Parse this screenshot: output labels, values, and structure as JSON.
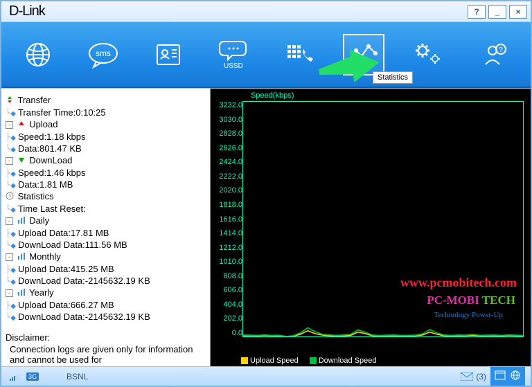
{
  "app": {
    "brand": "D-Link"
  },
  "titlebar": {
    "help": "?",
    "min": "_",
    "close": "×"
  },
  "toolbar": {
    "internet": "",
    "sms": "sms",
    "contacts": "",
    "ussd": "USSD",
    "call": "",
    "stats": "",
    "settings": "",
    "support": "",
    "tooltip": "Statistics"
  },
  "tree": {
    "transfer": {
      "label": "Transfer",
      "transfer_time": "Transfer Time:0:10:25",
      "upload": {
        "label": "Upload",
        "speed": "Speed:1.18 kbps",
        "data": "Data:801.47 KB"
      },
      "download": {
        "label": "DownLoad",
        "speed": "Speed:1.46 kbps",
        "data": "Data:1.81 MB"
      }
    },
    "statistics": {
      "label": "Statistics",
      "time_last_reset": "Time Last Reset:",
      "daily": {
        "label": "Daily",
        "upload": "Upload Data:17.81 MB",
        "download": "DownLoad Data:111.56 MB"
      },
      "monthly": {
        "label": "Monthly",
        "upload": "Upload Data:415.25 MB",
        "download": "DownLoad Data:-2145632.19 KB"
      },
      "yearly": {
        "label": "Yearly",
        "upload": "Upload Data:666.27 MB",
        "download": "DownLoad Data:-2145632.19 KB"
      }
    },
    "disclaimer": {
      "title": "Disclaimer:",
      "body": "Connection logs are given only for information and cannot be used for"
    }
  },
  "chart_data": {
    "type": "line",
    "title": "Speed(kbps)",
    "ylabel": "",
    "ylim": [
      0,
      3232
    ],
    "yticks": [
      3232.0,
      3030.0,
      2828.0,
      2626.0,
      2424.0,
      2222.0,
      2020.0,
      1818.0,
      1616.0,
      1414.0,
      1212.0,
      1010.0,
      808.0,
      606.0,
      404.0,
      202.0,
      0
    ],
    "series": [
      {
        "name": "Upload Speed",
        "color": "#ffd000",
        "values": [
          10,
          12,
          8,
          14,
          9,
          11,
          0,
          5,
          30,
          80,
          40,
          20,
          10,
          5,
          8,
          15,
          60,
          40,
          10,
          5,
          10,
          12,
          8,
          6,
          10,
          20,
          60,
          30,
          10,
          8,
          12,
          10,
          15,
          9,
          10,
          12,
          8,
          14,
          10,
          6
        ]
      },
      {
        "name": "Download Speed",
        "color": "#00c040",
        "values": [
          20,
          18,
          15,
          22,
          14,
          17,
          0,
          10,
          50,
          120,
          70,
          30,
          22,
          15,
          20,
          30,
          90,
          60,
          20,
          12,
          18,
          20,
          15,
          14,
          18,
          35,
          95,
          50,
          20,
          15,
          20,
          18,
          28,
          16,
          18,
          20,
          15,
          22,
          18,
          12
        ]
      }
    ],
    "legend": [
      "Upload Speed",
      "Download Speed"
    ]
  },
  "statusbar": {
    "operator": "BSNL",
    "mode": "3G",
    "msgcount": "(3)"
  },
  "watermark": {
    "url": "www.pcmobitech.com",
    "brand_pcmobi": "PC-MOBI",
    "brand_tech": "TECH",
    "tagline": "Technology Power-Up"
  }
}
